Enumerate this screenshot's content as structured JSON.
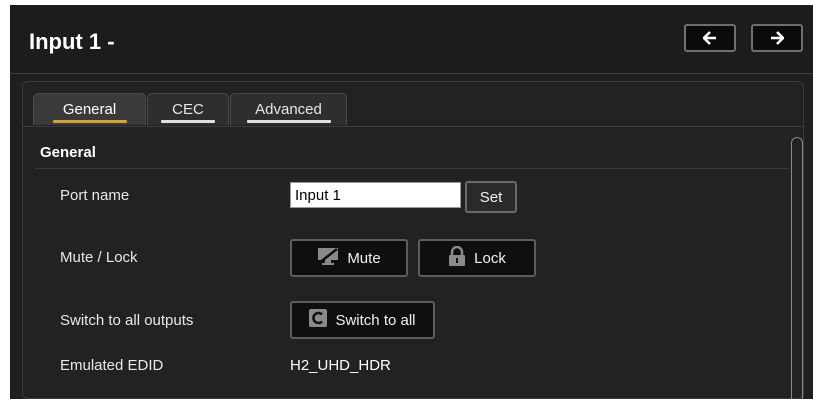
{
  "header": {
    "title": "Input 1 -",
    "prev_icon": "arrow-left-icon",
    "next_icon": "arrow-right-icon"
  },
  "tabs": [
    {
      "label": "General",
      "active": true,
      "underline_color": "#d4a13a"
    },
    {
      "label": "CEC",
      "active": false,
      "underline_color": "#e0e0e0"
    },
    {
      "label": "Advanced",
      "active": false,
      "underline_color": "#e0e0e0"
    }
  ],
  "section": {
    "title": "General"
  },
  "fields": {
    "port_name": {
      "label": "Port name",
      "value": "Input 1",
      "button": "Set"
    },
    "mute_lock": {
      "label": "Mute / Lock",
      "mute_button": "Mute",
      "mute_icon": "muted-display-icon",
      "lock_button": "Lock",
      "lock_icon": "lock-icon"
    },
    "switch_all": {
      "label": "Switch to all outputs",
      "button": "Switch to all",
      "icon": "switch-icon"
    },
    "edid": {
      "label": "Emulated EDID",
      "value": "H2_UHD_HDR"
    }
  },
  "colors": {
    "background": "#1f1f1f",
    "active_tab_underline": "#d4a13a",
    "inactive_tab_underline": "#e0e0e0"
  }
}
